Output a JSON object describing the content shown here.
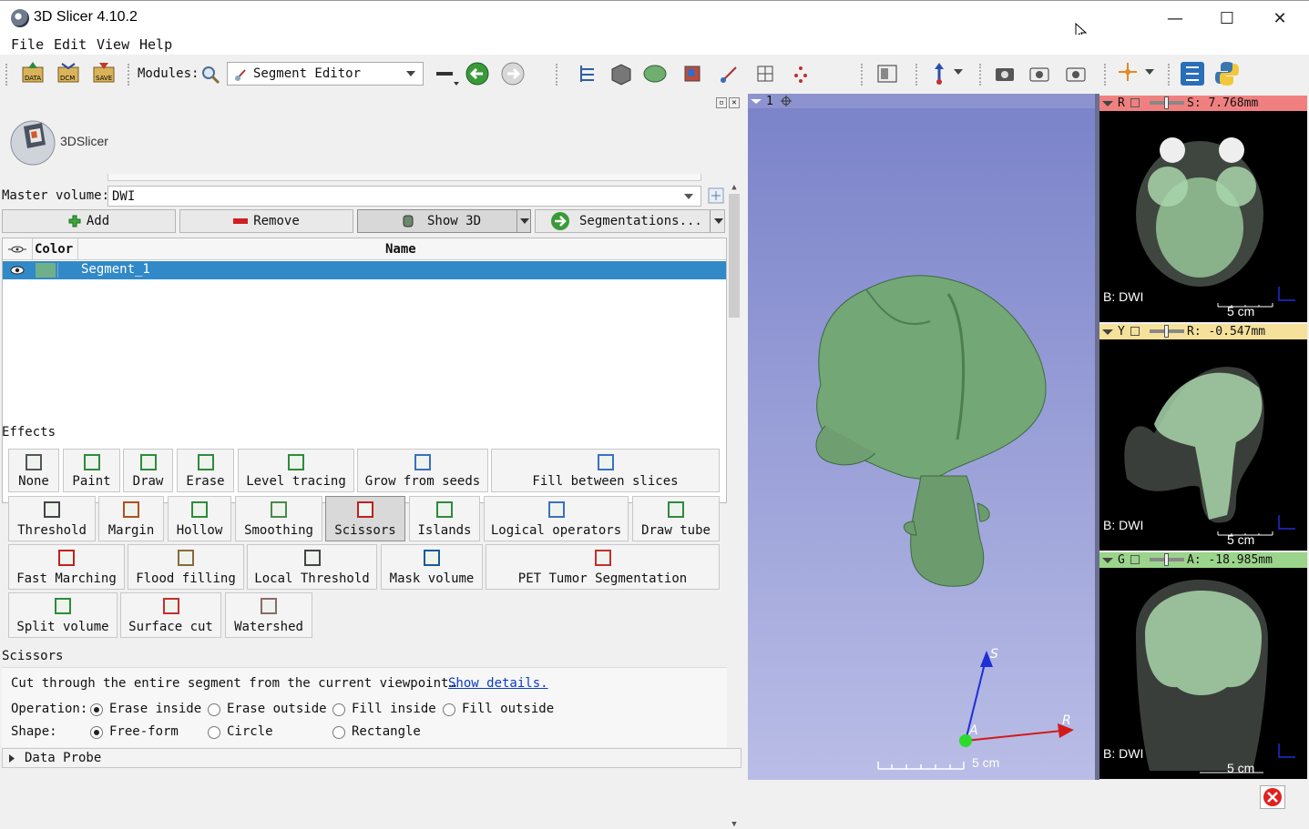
{
  "window": {
    "title": "3D Slicer 4.10.2",
    "min_glyph": "—",
    "max_glyph": "☐",
    "close_glyph": "✕"
  },
  "menu": {
    "file": "File",
    "edit": "Edit",
    "view": "View",
    "help": "Help"
  },
  "toolbar": {
    "modules_label": "Modules:",
    "module_selected": "Segment Editor",
    "icons": [
      "data-icon",
      "dcm-icon",
      "save-icon",
      "search-icon",
      "view-layout-icon",
      "back-icon",
      "forward-icon"
    ]
  },
  "logo": {
    "text": "3DSlicer"
  },
  "editor": {
    "master_volume_label": "Master volume:",
    "master_volume_value": "DWI",
    "add_label": "Add",
    "remove_label": "Remove",
    "show3d_label": "Show 3D",
    "segmentations_label": "Segmentations...",
    "table_headers": {
      "color": "Color",
      "name": "Name"
    },
    "segments": [
      {
        "name": "Segment_1",
        "color": "#6fb08a"
      }
    ]
  },
  "effects_title": "Effects",
  "effects": [
    "None",
    "Paint",
    "Draw",
    "Erase",
    "Level tracing",
    "Grow from seeds",
    "Fill between slices",
    "Threshold",
    "Margin",
    "Hollow",
    "Smoothing",
    "Scissors",
    "Islands",
    "Logical operators",
    "Draw tube",
    "Fast Marching",
    "Flood filling",
    "Local Threshold",
    "Mask volume",
    "PET Tumor Segmentation",
    "Split volume",
    "Surface cut",
    "Watershed"
  ],
  "scissors": {
    "title": "Scissors",
    "description": "Cut through the entire segment from the current viewpoint…",
    "details_link": "Show details.",
    "operation_label": "Operation:",
    "operations": [
      "Erase inside",
      "Erase outside",
      "Fill inside",
      "Fill outside"
    ],
    "shape_label": "Shape:",
    "shapes": [
      "Free-form",
      "Circle",
      "Rectangle"
    ]
  },
  "data_probe": "Data Probe",
  "view3d": {
    "index": "1",
    "axis_s": "S",
    "axis_r": "R",
    "axis_a": "A",
    "scale": "5 cm"
  },
  "slices": {
    "red": {
      "letter": "R",
      "offset": "S: 7.768mm",
      "label": "B: DWI",
      "scale": "5 cm",
      "color": "#f08080"
    },
    "yellow": {
      "letter": "Y",
      "offset": "R: -0.547mm",
      "label": "B: DWI",
      "scale": "5 cm",
      "color": "#f5e19a"
    },
    "green": {
      "letter": "G",
      "offset": "A: -18.985mm",
      "label": "B: DWI",
      "scale": "5 cm",
      "color": "#9bd48b"
    }
  }
}
